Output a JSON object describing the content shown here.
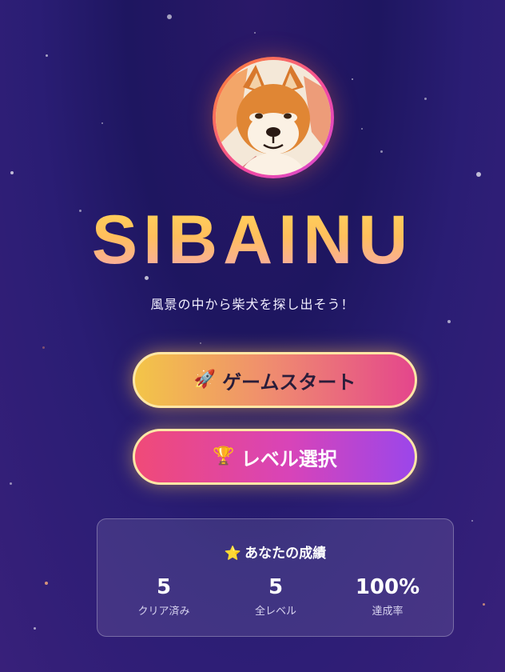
{
  "app": {
    "title": "SIBAINU",
    "subtitle": "風景の中から柴犬を探し出そう！"
  },
  "avatar": {
    "icon": "shiba-inu-dog"
  },
  "buttons": {
    "start": {
      "icon": "🚀",
      "label": "ゲームスタート"
    },
    "level_select": {
      "icon": "🏆",
      "label": "レベル選択"
    }
  },
  "stats": {
    "icon": "⭐",
    "title": "あなたの成績",
    "items": [
      {
        "value": "5",
        "label": "クリア済み"
      },
      {
        "value": "5",
        "label": "全レベル"
      },
      {
        "value": "100%",
        "label": "達成率"
      }
    ]
  },
  "colors": {
    "title_gradient": [
      "#ffd65a",
      "#f7a6b4"
    ],
    "start_button_gradient": [
      "#f3c548",
      "#e4468c"
    ],
    "level_button_gradient": [
      "#f04a78",
      "#9b46ea"
    ],
    "button_border": "#ffe7a6",
    "background": "#1e1660"
  }
}
